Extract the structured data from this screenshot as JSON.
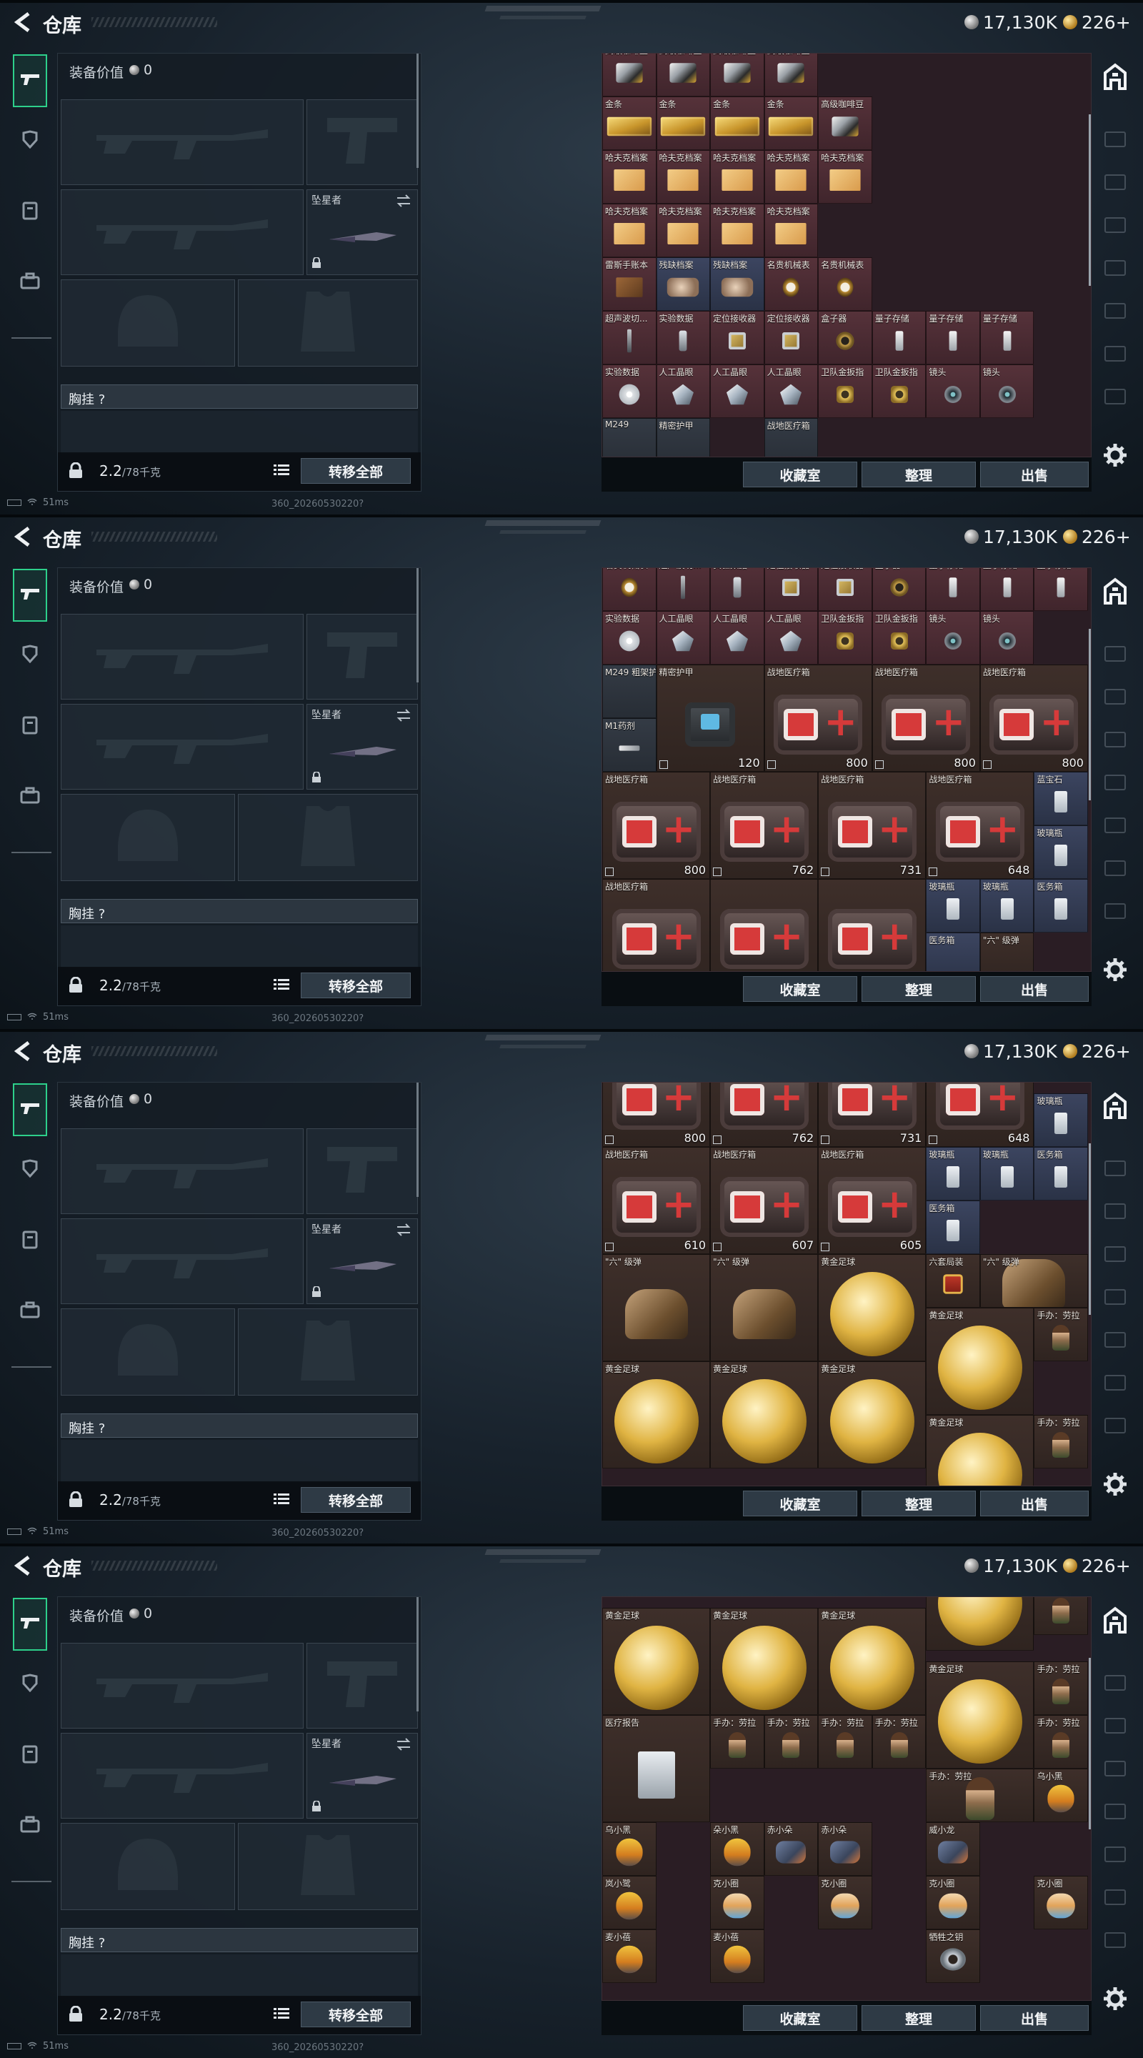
{
  "header": {
    "title": "仓库",
    "silver_amount": "17,130K",
    "gold_amount": "226+"
  },
  "loadout": {
    "equip_label": "装备价值",
    "equip_value": "0",
    "melee_name": "坠星者",
    "chest_label": "胸挂 ?",
    "weight": "2.2",
    "weight_unit": "/78千克",
    "transfer_label": "转移全部"
  },
  "status": {
    "ping": "51ms",
    "build": "360_20260530220?"
  },
  "stash_buttons": {
    "collection": "收藏室",
    "sort": "整理",
    "sell": "出售"
  },
  "icons": {
    "back": "back-arrow-icon",
    "silver": "silver-coin-icon",
    "gold": "gold-coin-icon",
    "gun_tab": "gun-icon",
    "armor_tab": "armor-icon",
    "vest_tab": "vest-icon",
    "case_tab": "briefcase-icon",
    "vault": "vault-icon",
    "settings": "gear-icon"
  },
  "colors": {
    "accent": "#2dd08b",
    "stash_red": "#56323a",
    "stash_blue": "#3c4560"
  },
  "screens": [
    {
      "cells": [
        {
          "label": "高级咖啡豆",
          "art": "coffee",
          "bg": "red"
        },
        {
          "label": "高级咖啡豆",
          "art": "coffee",
          "bg": "red"
        },
        {
          "label": "高级咖啡豆",
          "art": "coffee",
          "bg": "red"
        },
        {
          "label": "高级咖啡豆",
          "art": "coffee",
          "bg": "red"
        },
        {
          "label": "高级咖啡豆",
          "art": "coffee",
          "bg": "red"
        },
        {
          "label": "金条",
          "art": "gold-bar",
          "bg": "red"
        },
        {
          "label": "金条",
          "art": "gold-bar",
          "bg": "red"
        },
        {
          "label": "金条",
          "art": "gold-bar",
          "bg": "red"
        },
        {
          "label": "金条",
          "art": "gold-bar",
          "bg": "red"
        },
        {
          "label": "哈夫克档案",
          "art": "file",
          "bg": "red"
        },
        {
          "label": "哈夫克档案",
          "art": "file",
          "bg": "red"
        },
        {
          "label": "哈夫克档案",
          "art": "file",
          "bg": "red"
        },
        {
          "label": "哈夫克档案",
          "art": "file",
          "bg": "red"
        },
        {
          "label": "哈夫克档案",
          "art": "file",
          "bg": "red"
        },
        {
          "label": "哈夫克档案",
          "art": "file",
          "bg": "red"
        },
        {
          "label": "哈夫克档案",
          "art": "file",
          "bg": "red"
        },
        {
          "label": "哈夫克档案",
          "art": "file",
          "bg": "red"
        },
        {
          "label": "哈夫克档案",
          "art": "file",
          "bg": "red"
        },
        {
          "label": "雷斯手账本",
          "art": "book",
          "bg": "red"
        },
        {
          "label": "残缺档案",
          "art": "fossil",
          "bg": "blue"
        },
        {
          "label": "残缺档案",
          "art": "fossil",
          "bg": "blue"
        },
        {
          "label": "名贵机械表",
          "art": "watch",
          "bg": "red"
        },
        {
          "label": "名贵机械表",
          "art": "watch",
          "bg": "red"
        },
        {
          "label": "超声波切...",
          "art": "pen",
          "bg": "red"
        },
        {
          "label": "实验数据",
          "art": "cell",
          "bg": "red"
        },
        {
          "label": "定位接收器",
          "art": "device",
          "bg": "red"
        },
        {
          "label": "定位接收器",
          "art": "device",
          "bg": "red"
        },
        {
          "label": "盒子器",
          "art": "boxring",
          "bg": "red"
        },
        {
          "label": "量子存储",
          "art": "usb",
          "bg": "red"
        },
        {
          "label": "量子存储",
          "art": "usb",
          "bg": "red"
        },
        {
          "label": "量子存储",
          "art": "usb",
          "bg": "red"
        },
        {
          "label": "实验数据",
          "art": "disc",
          "bg": "red"
        },
        {
          "label": "人工晶眼",
          "art": "crystal",
          "bg": "red"
        },
        {
          "label": "人工晶眼",
          "art": "crystal",
          "bg": "red"
        },
        {
          "label": "人工晶眼",
          "art": "crystal",
          "bg": "red"
        },
        {
          "label": "卫队金扳指",
          "art": "ring",
          "bg": "red"
        },
        {
          "label": "卫队金扳指",
          "art": "ring",
          "bg": "red"
        },
        {
          "label": "镜头",
          "art": "lens",
          "bg": "red"
        },
        {
          "label": "镜头",
          "art": "lens",
          "bg": "red"
        },
        {
          "label": "M249",
          "art": "",
          "bg": "slate"
        },
        {
          "label": "精密护甲",
          "art": "",
          "bg": "slate"
        },
        {
          "label": "战地医疗箱",
          "art": "",
          "bg": "slate"
        }
      ]
    },
    {
      "cells": [
        {
          "label": "名贵机械表",
          "art": "watch",
          "bg": "red"
        },
        {
          "label": "超声波切...",
          "art": "pen",
          "bg": "red"
        },
        {
          "label": "实验数据",
          "art": "cell",
          "bg": "red"
        },
        {
          "label": "定位接收器",
          "art": "device",
          "bg": "red"
        },
        {
          "label": "定位接收器",
          "art": "device",
          "bg": "red"
        },
        {
          "label": "盒子器",
          "art": "boxring",
          "bg": "red"
        },
        {
          "label": "量子存储",
          "art": "usb",
          "bg": "red"
        },
        {
          "label": "量子存储",
          "art": "usb",
          "bg": "red"
        },
        {
          "label": "量子存储",
          "art": "usb",
          "bg": "red"
        },
        {
          "label": "实验数据",
          "art": "disc",
          "bg": "red"
        },
        {
          "label": "人工晶眼",
          "art": "crystal",
          "bg": "red"
        },
        {
          "label": "人工晶眼",
          "art": "crystal",
          "bg": "red"
        },
        {
          "label": "人工晶眼",
          "art": "crystal",
          "bg": "red"
        },
        {
          "label": "卫队金扳指",
          "art": "ring",
          "bg": "red"
        },
        {
          "label": "卫队金扳指",
          "art": "ring",
          "bg": "red"
        },
        {
          "label": "镜头",
          "art": "lens",
          "bg": "red"
        },
        {
          "label": "镜头",
          "art": "lens",
          "bg": "red"
        },
        {
          "label": "M249 粗架护木",
          "art": "",
          "bg": "slate"
        },
        {
          "label": "精密护甲",
          "art": "bag",
          "bg": "brown",
          "count": "120"
        },
        {
          "label": "战地医疗箱",
          "art": "medkit",
          "bg": "brown",
          "count": "800"
        },
        {
          "label": "战地医疗箱",
          "art": "medkit",
          "bg": "brown",
          "count": "800"
        },
        {
          "label": "战地医疗箱",
          "art": "medkit",
          "bg": "brown",
          "count": "800"
        },
        {
          "label": "M1药剂",
          "art": "syringe",
          "bg": "slate"
        },
        {
          "label": "战地医疗箱",
          "art": "medkit",
          "bg": "brown",
          "count": "800"
        },
        {
          "label": "战地医疗箱",
          "art": "medkit",
          "bg": "brown",
          "count": "762"
        },
        {
          "label": "战地医疗箱",
          "art": "medkit",
          "bg": "brown",
          "count": "731"
        },
        {
          "label": "战地医疗箱",
          "art": "medkit",
          "bg": "brown",
          "count": "648"
        },
        {
          "label": "蓝宝石",
          "art": "vial",
          "bg": "blue"
        },
        {
          "label": "玻璃瓶",
          "art": "vial",
          "bg": "blue"
        },
        {
          "label": "战地医疗箱",
          "art": "medkit",
          "bg": "brown"
        },
        {
          "label": "",
          "art": "medkit",
          "bg": "brown"
        },
        {
          "label": "",
          "art": "medkit",
          "bg": "brown"
        },
        {
          "label": "玻璃瓶",
          "art": "vial",
          "bg": "blue"
        },
        {
          "label": "玻璃瓶",
          "art": "vial",
          "bg": "blue"
        },
        {
          "label": "医务箱",
          "art": "vial",
          "bg": "blue"
        },
        {
          "label": "医务箱",
          "art": "",
          "bg": "blue"
        },
        {
          "label": "\"六\" 级弹",
          "art": "",
          "bg": "brown"
        }
      ]
    },
    {
      "cells": [
        {
          "label": "",
          "art": "medkit",
          "bg": "brown",
          "count": "800"
        },
        {
          "label": "",
          "art": "medkit",
          "bg": "brown",
          "count": "762"
        },
        {
          "label": "",
          "art": "medkit",
          "bg": "brown",
          "count": "731"
        },
        {
          "label": "",
          "art": "medkit",
          "bg": "brown",
          "count": "648"
        },
        {
          "label": "玻璃瓶",
          "art": "vial",
          "bg": "blue"
        },
        {
          "label": "战地医疗箱",
          "art": "medkit",
          "bg": "brown",
          "count": "610"
        },
        {
          "label": "战地医疗箱",
          "art": "medkit",
          "bg": "brown",
          "count": "607"
        },
        {
          "label": "战地医疗箱",
          "art": "medkit",
          "bg": "brown",
          "count": "605"
        },
        {
          "label": "玻璃瓶",
          "art": "vial",
          "bg": "blue"
        },
        {
          "label": "玻璃瓶",
          "art": "vial",
          "bg": "blue"
        },
        {
          "label": "医务箱",
          "art": "vial",
          "bg": "blue"
        },
        {
          "label": "医务箱",
          "art": "vial",
          "bg": "blue"
        },
        {
          "label": "\"六\" 级弹",
          "art": "dog",
          "bg": "brown"
        },
        {
          "label": "\"六\" 级弹",
          "art": "dog",
          "bg": "brown"
        },
        {
          "label": "\"六\" 级弹",
          "art": "dog",
          "bg": "brown"
        },
        {
          "label": "黄金足球",
          "art": "ball",
          "bg": "brown"
        },
        {
          "label": "六套局装",
          "art": "pouch",
          "bg": "brown"
        },
        {
          "label": "黄金足球",
          "art": "ball",
          "bg": "brown"
        },
        {
          "label": "手办：劳拉",
          "art": "figure",
          "bg": "brown"
        },
        {
          "label": "黄金足球",
          "art": "ball",
          "bg": "brown"
        },
        {
          "label": "黄金足球",
          "art": "ball",
          "bg": "brown"
        },
        {
          "label": "黄金足球",
          "art": "ball",
          "bg": "brown"
        },
        {
          "label": "黄金足球",
          "art": "ball",
          "bg": "brown"
        },
        {
          "label": "手办：劳拉",
          "art": "figure",
          "bg": "brown"
        }
      ]
    },
    {
      "cells": [
        {
          "label": "",
          "art": "ball",
          "bg": "brown"
        },
        {
          "label": "",
          "art": "figure",
          "bg": "brown"
        },
        {
          "label": "黄金足球",
          "art": "ball",
          "bg": "brown"
        },
        {
          "label": "黄金足球",
          "art": "ball",
          "bg": "brown"
        },
        {
          "label": "黄金足球",
          "art": "ball",
          "bg": "brown"
        },
        {
          "label": "黄金足球",
          "art": "ball",
          "bg": "brown"
        },
        {
          "label": "手办：劳拉",
          "art": "figure",
          "bg": "brown"
        },
        {
          "label": "医疗报告",
          "art": "report",
          "bg": "brown"
        },
        {
          "label": "手办：劳拉",
          "art": "figure",
          "bg": "brown"
        },
        {
          "label": "手办：劳拉",
          "art": "figure",
          "bg": "brown"
        },
        {
          "label": "手办：劳拉",
          "art": "figure",
          "bg": "brown"
        },
        {
          "label": "手办：劳拉",
          "art": "figure",
          "bg": "brown"
        },
        {
          "label": "手办：劳拉",
          "art": "figure",
          "bg": "brown"
        },
        {
          "label": "手办：劳拉",
          "art": "figure",
          "bg": "brown"
        },
        {
          "label": "乌小黑",
          "art": "chick",
          "bg": "brown"
        },
        {
          "label": "乌小黑",
          "art": "chick",
          "bg": "brown"
        },
        {
          "label": "朵小黑",
          "art": "chick",
          "bg": "brown"
        },
        {
          "label": "赤小朵",
          "art": "toy",
          "bg": "brown"
        },
        {
          "label": "赤小朵",
          "art": "toy",
          "bg": "brown"
        },
        {
          "label": "威小龙",
          "art": "toy",
          "bg": "brown"
        },
        {
          "label": "岚小鹭",
          "art": "chick",
          "bg": "brown"
        },
        {
          "label": "克小圈",
          "art": "cat",
          "bg": "brown"
        },
        {
          "label": "克小圈",
          "art": "cat",
          "bg": "brown"
        },
        {
          "label": "克小圈",
          "art": "cat",
          "bg": "brown"
        },
        {
          "label": "克小圈",
          "art": "cat",
          "bg": "brown"
        },
        {
          "label": "麦小蓓",
          "art": "chick",
          "bg": "brown"
        },
        {
          "label": "麦小蓓",
          "art": "chick",
          "bg": "brown"
        },
        {
          "label": "牺牲之钥",
          "art": "key",
          "bg": "brown"
        }
      ]
    }
  ]
}
